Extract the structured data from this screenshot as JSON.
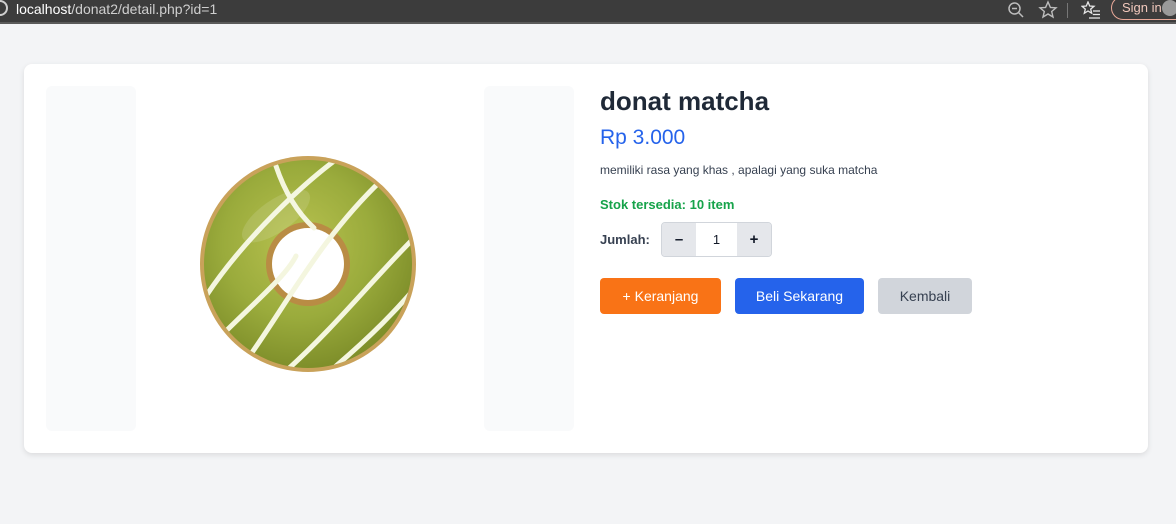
{
  "browser": {
    "url_host": "localhost",
    "url_path": "/donat2/detail.php?id=1",
    "signin_label": "Sign in",
    "icons": [
      "zoom-out-icon",
      "star-icon",
      "favorites-icon",
      "profile-avatar-icon"
    ]
  },
  "product": {
    "name": "donat matcha",
    "price": "Rp 3.000",
    "description": "memiliki rasa yang khas , apalagi yang suka matcha",
    "stock_text": "Stok tersedia: 10 item",
    "image_icon": "donut-image"
  },
  "quantity": {
    "label": "Jumlah:",
    "minus_label": "–",
    "plus_label": "+",
    "value": "1"
  },
  "actions": {
    "cart_label": "+ Keranjang",
    "buy_label": "Beli Sekarang",
    "back_label": "Kembali"
  },
  "colors": {
    "page_bg": "#f3f4f6",
    "price": "#2563eb",
    "stock": "#16a34a",
    "cart_button": "#f97316",
    "buy_button": "#2563eb",
    "back_button": "#d1d5db",
    "donut_glaze": "#9aab3c"
  }
}
